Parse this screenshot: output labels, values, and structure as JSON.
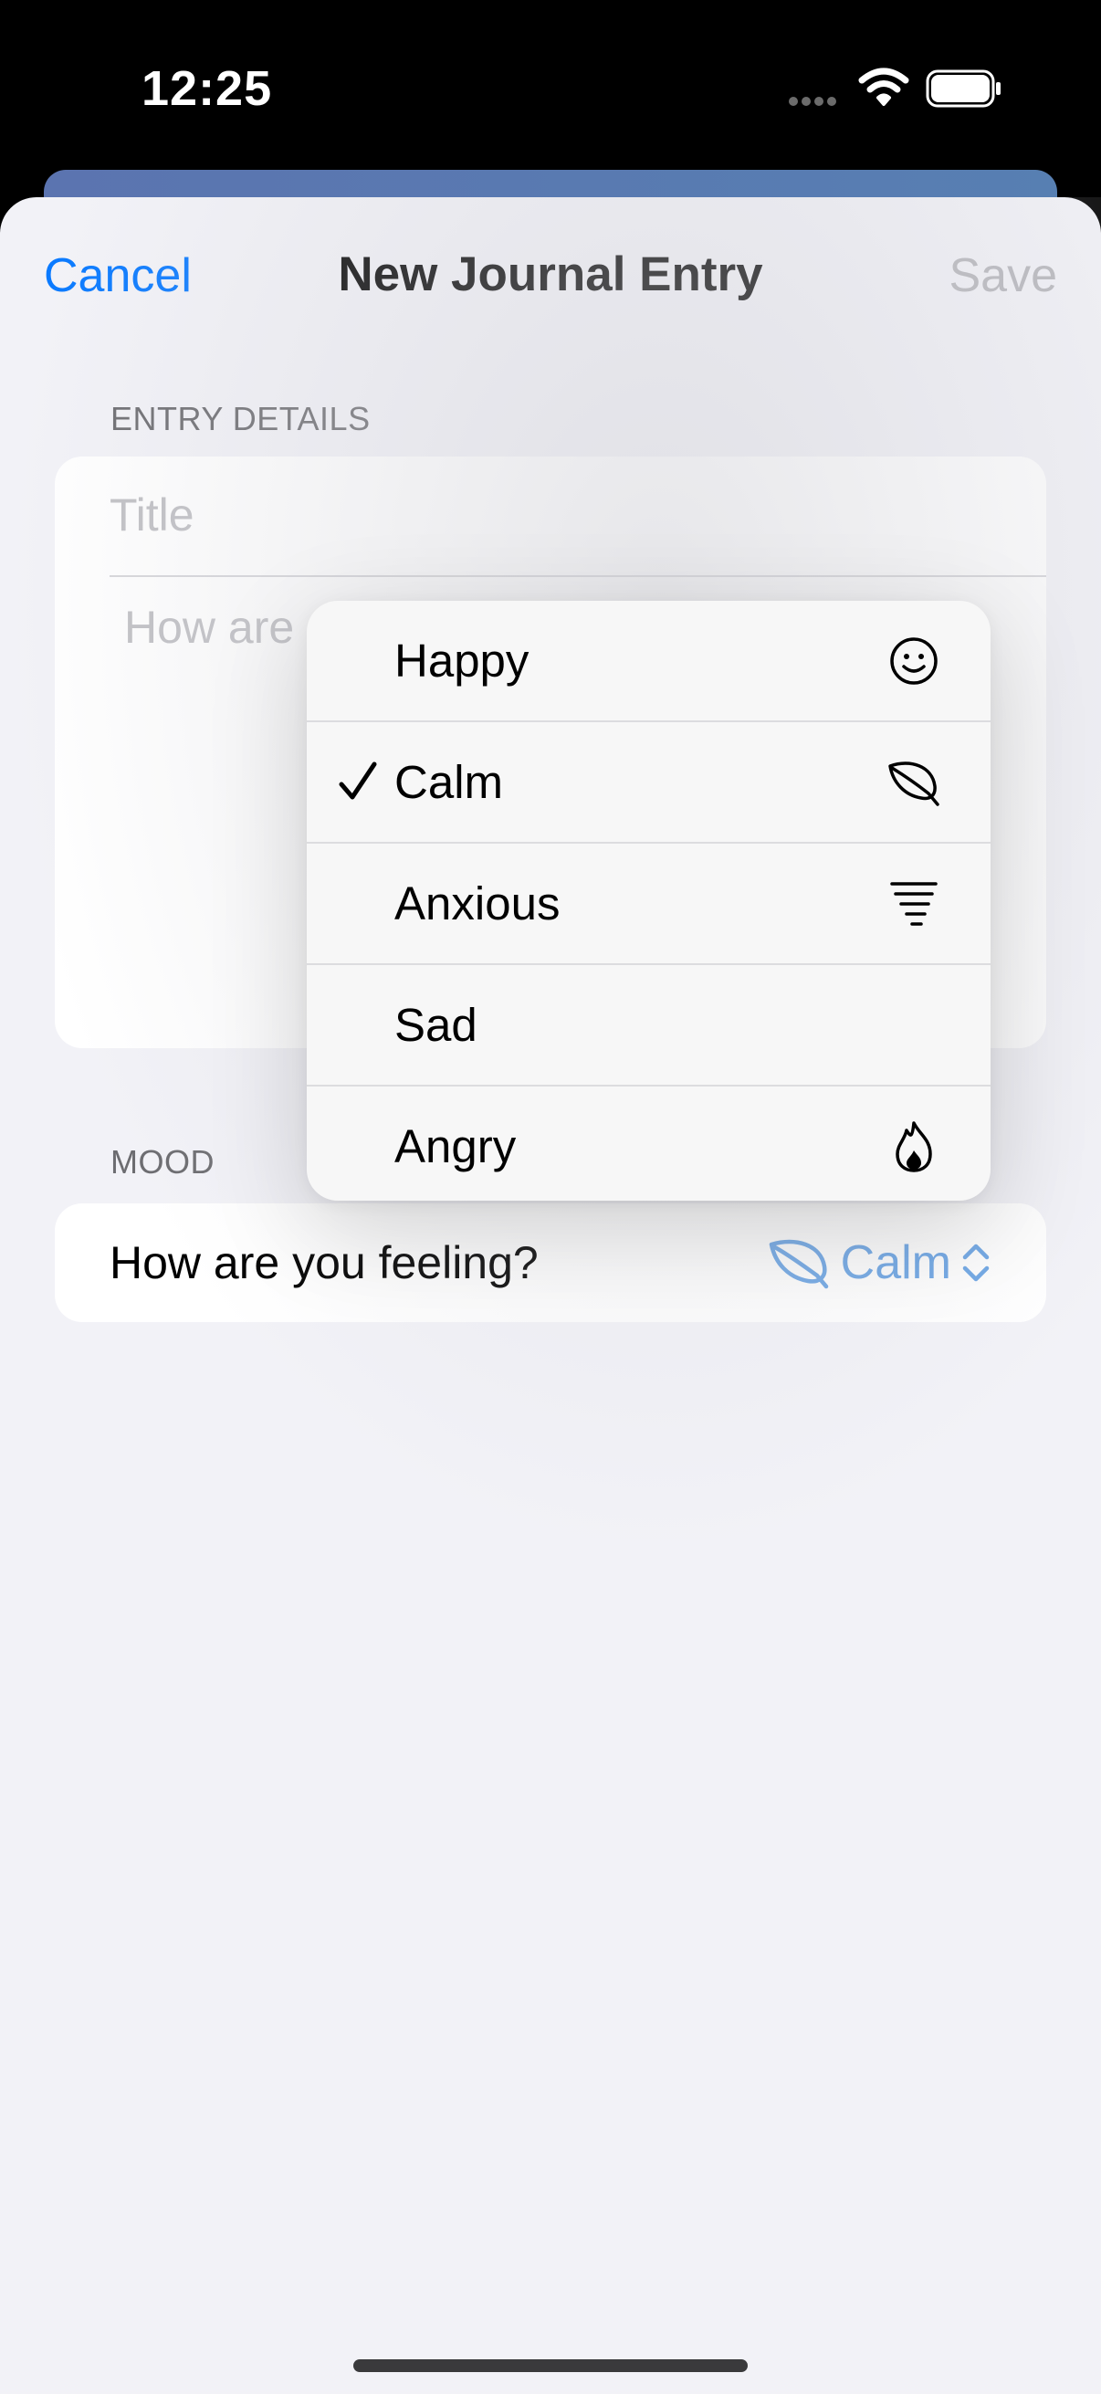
{
  "status_bar": {
    "time": "12:25"
  },
  "nav": {
    "cancel_label": "Cancel",
    "title": "New Journal Entry",
    "save_label": "Save"
  },
  "entry_section": {
    "header": "ENTRY DETAILS",
    "title_placeholder": "Title",
    "body_placeholder": "How are"
  },
  "mood_section": {
    "header": "MOOD",
    "prompt": "How are you feeling?",
    "selected_value": "Calm",
    "selected_icon": "leaf-icon",
    "accent_color": "#6ea7e6"
  },
  "menu": {
    "items": [
      {
        "label": "Happy",
        "icon": "smiley-icon",
        "checked": false
      },
      {
        "label": "Calm",
        "icon": "leaf-icon",
        "checked": true
      },
      {
        "label": "Anxious",
        "icon": "tornado-icon",
        "checked": false
      },
      {
        "label": "Sad",
        "icon": "",
        "checked": false
      },
      {
        "label": "Angry",
        "icon": "flame-icon",
        "checked": false
      }
    ]
  },
  "colors": {
    "link": "#0a7aff",
    "disabled": "#b7b7bc",
    "background": "#f2f2f7"
  }
}
